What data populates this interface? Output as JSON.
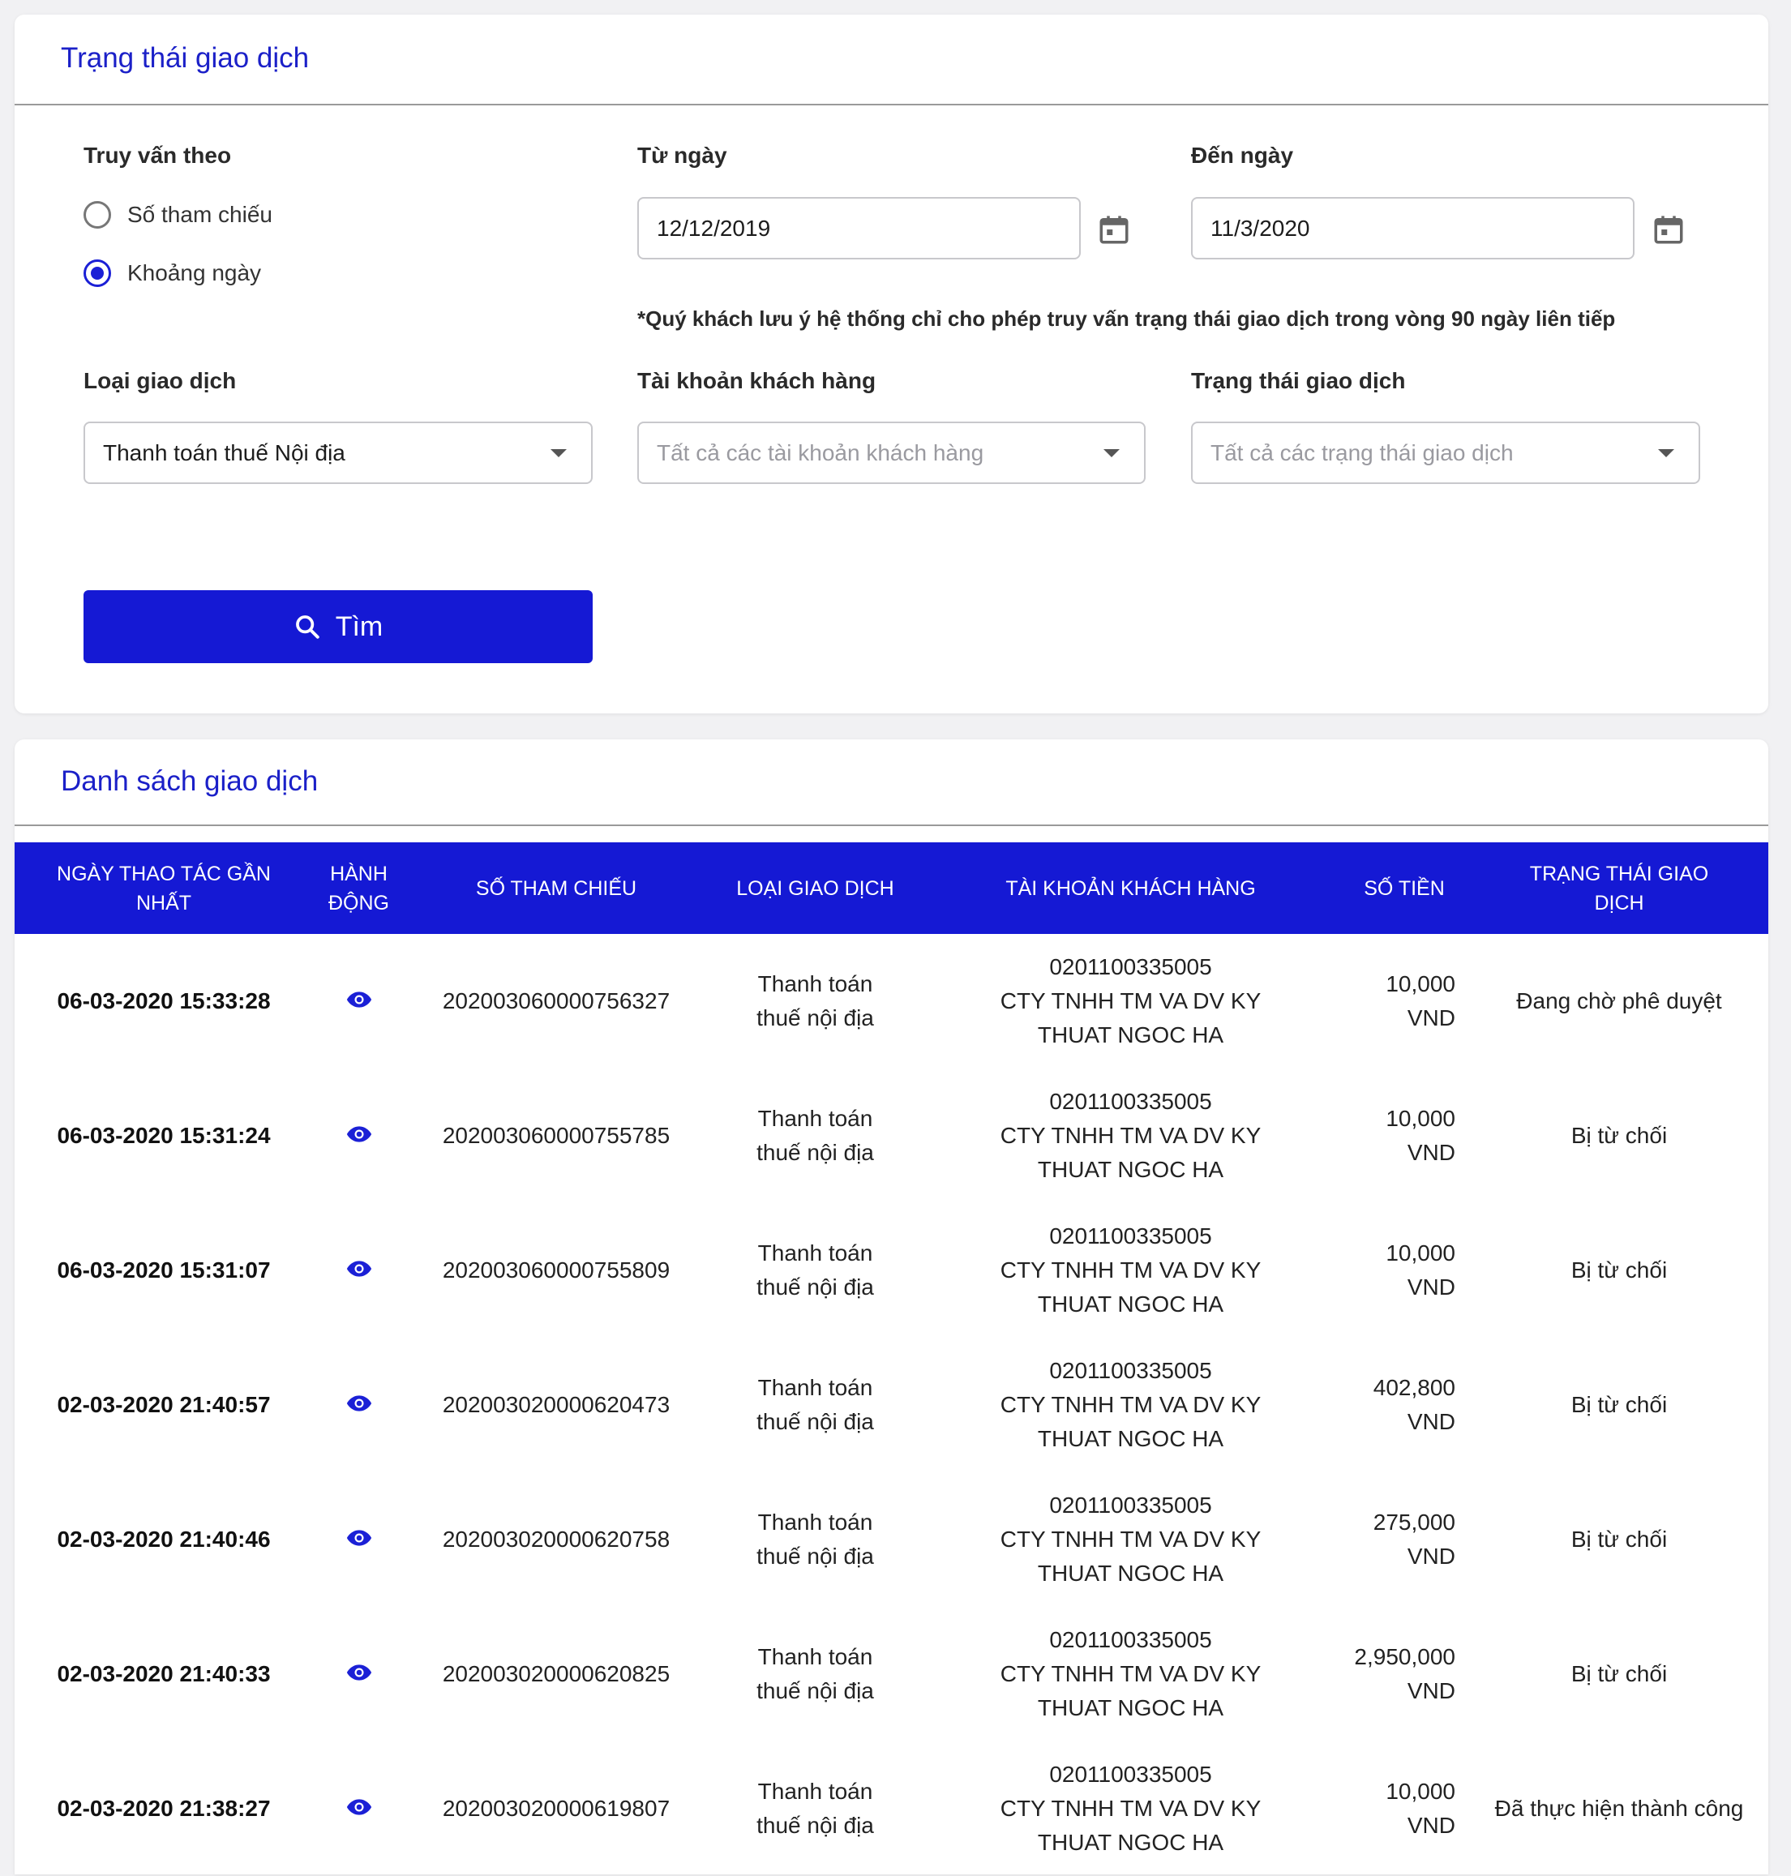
{
  "filter_panel": {
    "title": "Trạng thái giao dịch",
    "query_by_label": "Truy vấn theo",
    "radio_options": [
      {
        "label": "Số tham chiếu",
        "selected": false
      },
      {
        "label": "Khoảng ngày",
        "selected": true
      }
    ],
    "from_date_label": "Từ ngày",
    "from_date_value": "12/12/2019",
    "to_date_label": "Đến ngày",
    "to_date_value": "11/3/2020",
    "note": "*Quý khách lưu ý hệ thống chỉ cho phép truy vấn trạng thái giao dịch trong vòng 90 ngày liên tiếp",
    "tx_type_label": "Loại giao dịch",
    "tx_type_value": "Thanh toán thuế Nội địa",
    "account_label": "Tài khoản khách hàng",
    "account_placeholder": "Tất cả các tài khoản khách hàng",
    "status_label": "Trạng thái giao dịch",
    "status_placeholder": "Tất cả các trạng thái giao dịch",
    "search_button": "Tìm"
  },
  "list_panel": {
    "title": "Danh sách giao dịch",
    "columns": [
      "NGÀY THAO TÁC GẦN NHẤT",
      "HÀNH ĐỘNG",
      "SỐ THAM CHIẾU",
      "LOẠI GIAO DỊCH",
      "TÀI KHOẢN KHÁCH HÀNG",
      "SỐ TIỀN",
      "TRẠNG THÁI GIAO DỊCH"
    ],
    "rows": [
      {
        "date": "06-03-2020 15:33:28",
        "ref": "202003060000756327",
        "type": "Thanh toán thuế nội địa",
        "account_no": "0201100335005",
        "account_name": "CTY TNHH TM VA DV KY THUAT NGOC HA",
        "amount": "10,000 VND",
        "status": "Đang chờ phê duyệt"
      },
      {
        "date": "06-03-2020 15:31:24",
        "ref": "202003060000755785",
        "type": "Thanh toán thuế nội địa",
        "account_no": "0201100335005",
        "account_name": "CTY TNHH TM VA DV KY THUAT NGOC HA",
        "amount": "10,000 VND",
        "status": "Bị từ chối"
      },
      {
        "date": "06-03-2020 15:31:07",
        "ref": "202003060000755809",
        "type": "Thanh toán thuế nội địa",
        "account_no": "0201100335005",
        "account_name": "CTY TNHH TM VA DV KY THUAT NGOC HA",
        "amount": "10,000 VND",
        "status": "Bị từ chối"
      },
      {
        "date": "02-03-2020 21:40:57",
        "ref": "202003020000620473",
        "type": "Thanh toán thuế nội địa",
        "account_no": "0201100335005",
        "account_name": "CTY TNHH TM VA DV KY THUAT NGOC HA",
        "amount": "402,800 VND",
        "status": "Bị từ chối"
      },
      {
        "date": "02-03-2020 21:40:46",
        "ref": "202003020000620758",
        "type": "Thanh toán thuế nội địa",
        "account_no": "0201100335005",
        "account_name": "CTY TNHH TM VA DV KY THUAT NGOC HA",
        "amount": "275,000 VND",
        "status": "Bị từ chối"
      },
      {
        "date": "02-03-2020 21:40:33",
        "ref": "202003020000620825",
        "type": "Thanh toán thuế nội địa",
        "account_no": "0201100335005",
        "account_name": "CTY TNHH TM VA DV KY THUAT NGOC HA",
        "amount": "2,950,000 VND",
        "status": "Bị từ chối"
      },
      {
        "date": "02-03-2020 21:38:27",
        "ref": "202003020000619807",
        "type": "Thanh toán thuế nội địa",
        "account_no": "0201100335005",
        "account_name": "CTY TNHH TM VA DV KY THUAT NGOC HA",
        "amount": "10,000 VND",
        "status": "Đã thực hiện thành công"
      }
    ]
  },
  "colors": {
    "accent": "#1519d4",
    "title": "#1b20c8"
  }
}
